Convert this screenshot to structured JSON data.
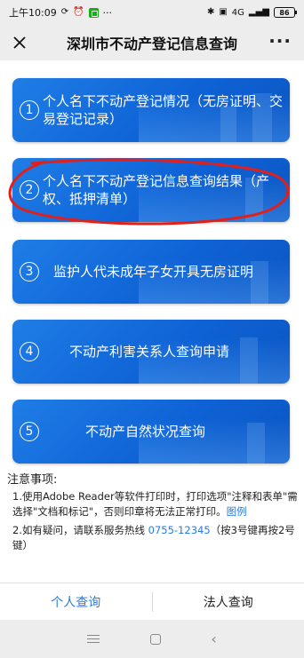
{
  "status_bar": {
    "time": "上午10:09",
    "left_icons": [
      "sync-icon",
      "alarm-icon",
      "app-icon"
    ],
    "dots": "···",
    "right_icons": [
      "bluetooth-icon",
      "nfc-icon",
      "signal-icon"
    ],
    "network": "4G",
    "battery": "86"
  },
  "title_bar": {
    "title": "深圳市不动产登记信息查询",
    "more": "···"
  },
  "menu": {
    "items": [
      {
        "number": "1",
        "label": "个人名下不动产登记情况（无房证明、交易登记记录）"
      },
      {
        "number": "2",
        "label": "个人名下不动产登记信息查询结果（产权、抵押清单）"
      },
      {
        "number": "3",
        "label": "监护人代未成年子女开具无房证明"
      },
      {
        "number": "4",
        "label": "不动产利害关系人查询申请"
      },
      {
        "number": "5",
        "label": "不动产自然状况查询"
      }
    ]
  },
  "notice": {
    "title": "注意事项:",
    "item1_text": "1.使用Adobe Reader等软件打印时，打印选项\"注释和表单\"需选择\"文档和标记\"，否则印章将无法正常打印。",
    "item1_link": "图例",
    "item2_prefix": "2.如有疑问，请联系服务热线 ",
    "item2_phone": "0755-12345",
    "item2_suffix": "（按3号键再按2号键）"
  },
  "tabs": {
    "personal": "个人查询",
    "legal": "法人查询"
  },
  "colors": {
    "button_blue": "#1f7de6",
    "link_blue": "#2a7ae2",
    "annotation_red": "#e0201b"
  }
}
